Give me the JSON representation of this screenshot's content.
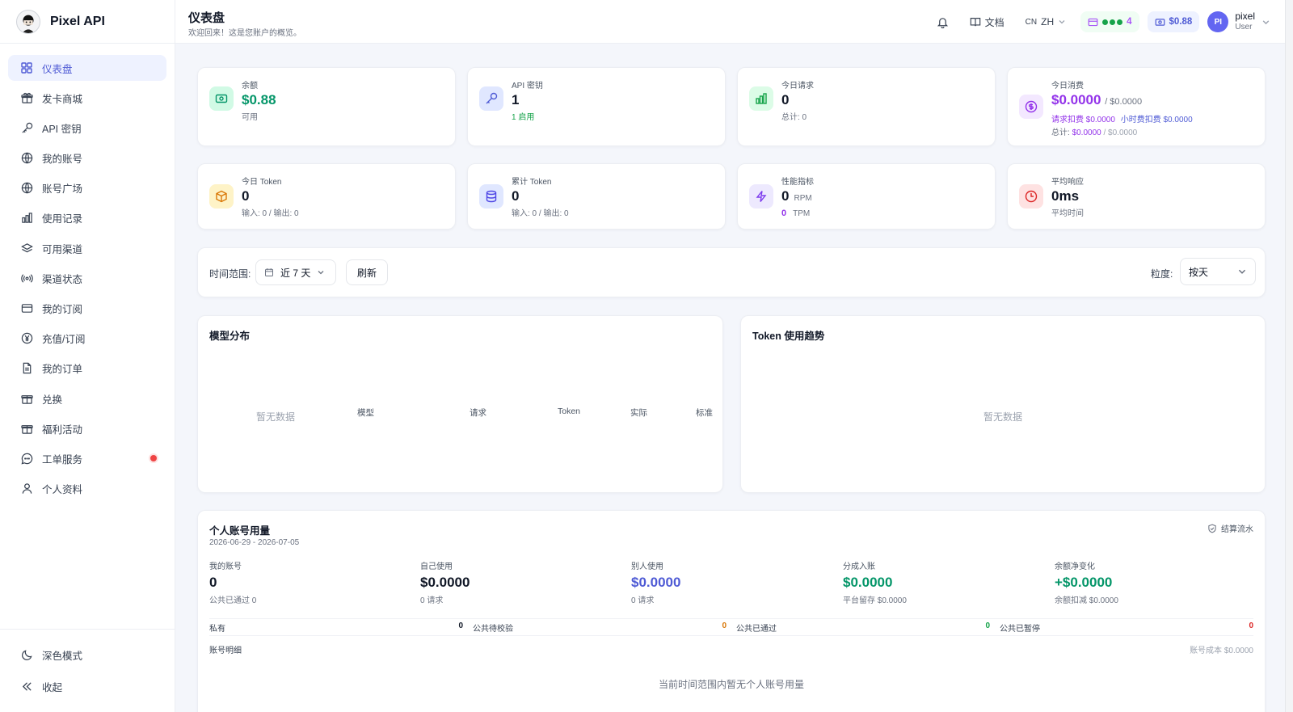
{
  "brand": {
    "name": "Pixel API"
  },
  "sidebar": {
    "items": [
      {
        "label": "仪表盘",
        "icon": "dashboard-icon",
        "active": true
      },
      {
        "label": "发卡商城",
        "icon": "gift-icon"
      },
      {
        "label": "API 密钥",
        "icon": "key-icon"
      },
      {
        "label": "我的账号",
        "icon": "globe-icon"
      },
      {
        "label": "账号广场",
        "icon": "globe-icon"
      },
      {
        "label": "使用记录",
        "icon": "bar-chart-icon"
      },
      {
        "label": "可用渠道",
        "icon": "layers-icon"
      },
      {
        "label": "渠道状态",
        "icon": "signal-icon"
      },
      {
        "label": "我的订阅",
        "icon": "card-icon"
      },
      {
        "label": "充值/订阅",
        "icon": "yen-icon"
      },
      {
        "label": "我的订单",
        "icon": "file-icon"
      },
      {
        "label": "兑换",
        "icon": "gift-icon"
      },
      {
        "label": "福利活动",
        "icon": "gift-icon"
      },
      {
        "label": "工单服务",
        "icon": "chat-icon",
        "badge": true
      },
      {
        "label": "个人资料",
        "icon": "user-icon"
      }
    ],
    "bottom": {
      "dark_mode": "深色模式",
      "collapse": "收起"
    }
  },
  "header": {
    "title": "仪表盘",
    "subtitle": "欢迎回来！这是您账户的概览。",
    "docs": "文档",
    "lang_flag": "CN",
    "lang": "ZH",
    "status_count": "4",
    "balance": "$0.88",
    "user": {
      "initials": "PI",
      "name": "pixel",
      "role": "User"
    }
  },
  "stats": {
    "balance": {
      "label": "余额",
      "value": "$0.88",
      "sub": "可用"
    },
    "api_keys": {
      "label": "API 密钥",
      "value": "1",
      "sub": "1 启用"
    },
    "today_requests": {
      "label": "今日请求",
      "value": "0",
      "sub": "总计: 0"
    },
    "today_cost": {
      "label": "今日消费",
      "value": "$0.0000",
      "value_suffix": "/ $0.0000",
      "req_label": "请求扣费",
      "req_value": "$0.0000",
      "hour_label": "小时费扣费",
      "hour_value": "$0.0000",
      "total_label": "总计:",
      "total_value": "$0.0000",
      "total_suffix": "/ $0.0000"
    },
    "today_tokens": {
      "label": "今日 Token",
      "value": "0",
      "sub": "输入: 0 / 输出: 0"
    },
    "total_tokens": {
      "label": "累计 Token",
      "value": "0",
      "sub": "输入: 0 / 输出: 0"
    },
    "performance": {
      "label": "性能指标",
      "rpm_value": "0",
      "rpm_unit": "RPM",
      "tpm_value": "0",
      "tpm_unit": "TPM"
    },
    "avg_response": {
      "label": "平均响应",
      "value": "0ms",
      "sub": "平均时间"
    }
  },
  "filters": {
    "range_label": "时间范围:",
    "range_value": "近 7 天",
    "refresh": "刷新",
    "granularity_label": "粒度:",
    "granularity_value": "按天"
  },
  "model_dist": {
    "title": "模型分布",
    "empty": "暂无数据",
    "columns": [
      "模型",
      "请求",
      "Token",
      "实际",
      "标准"
    ]
  },
  "token_trend": {
    "title": "Token 使用趋势",
    "empty": "暂无数据"
  },
  "personal": {
    "title": "个人账号用量",
    "date_range": "2026-06-29 - 2026-07-05",
    "settle_link": "结算流水",
    "metrics": [
      {
        "label": "我的账号",
        "value": "0",
        "sub": "公共已通过 0",
        "color": "#111827"
      },
      {
        "label": "自己使用",
        "value": "$0.0000",
        "sub": "0 请求",
        "color": "#111827"
      },
      {
        "label": "别人使用",
        "value": "$0.0000",
        "sub": "0 请求",
        "color": "#4f5bd5"
      },
      {
        "label": "分成入账",
        "value": "$0.0000",
        "sub": "平台留存 $0.0000",
        "color": "#059669"
      },
      {
        "label": "余额净变化",
        "value": "+$0.0000",
        "sub": "余额扣减 $0.0000",
        "color": "#059669"
      }
    ],
    "status": [
      {
        "label": "私有",
        "value": "0",
        "color": "#111827"
      },
      {
        "label": "公共待校验",
        "value": "0",
        "color": "#d97706"
      },
      {
        "label": "公共已通过",
        "value": "0",
        "color": "#16a34a"
      },
      {
        "label": "公共已暂停",
        "value": "0",
        "color": "#dc2626"
      }
    ],
    "detail_label": "账号明细",
    "account_cost": "账号成本 $0.0000",
    "empty": "当前时间范围内暂无个人账号用量"
  },
  "colors": {
    "accent": "#4f5bd5",
    "green": "#059669",
    "purple": "#9333ea"
  }
}
